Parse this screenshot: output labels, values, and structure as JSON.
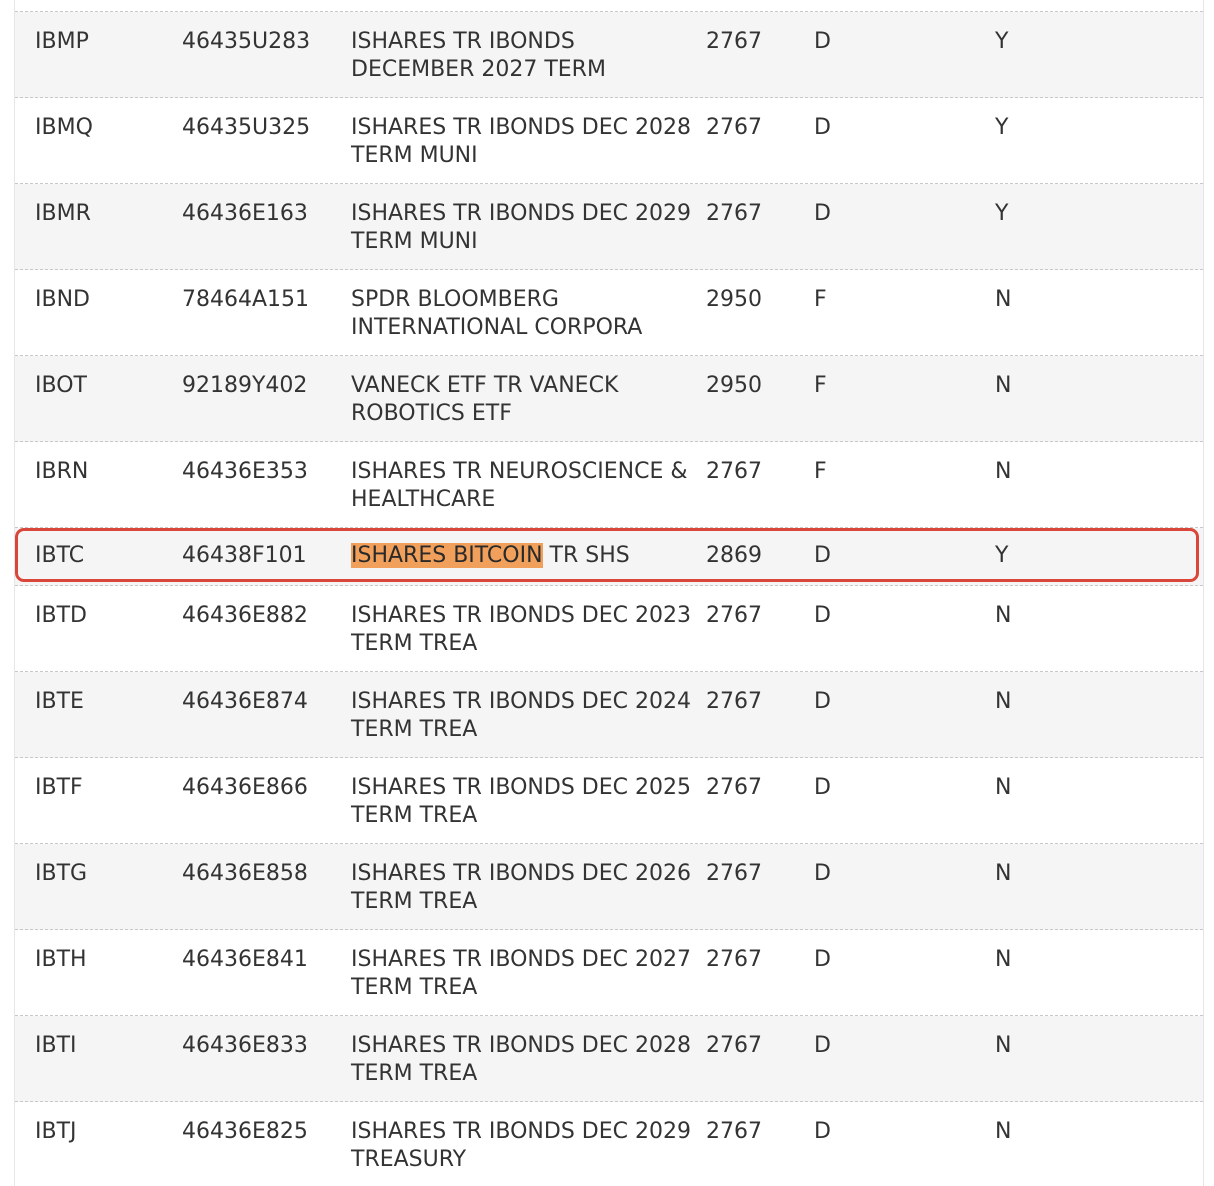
{
  "rows": [
    {
      "symbol": "IBMP",
      "cusip": "46435U283",
      "name1": "ISHARES TR IBONDS",
      "name2": "DECEMBER 2027 TERM",
      "code": "2767",
      "type": "D",
      "flag": "Y"
    },
    {
      "symbol": "IBMQ",
      "cusip": "46435U325",
      "name1": "ISHARES TR IBONDS DEC 2028",
      "name2": "TERM MUNI",
      "code": "2767",
      "type": "D",
      "flag": "Y"
    },
    {
      "symbol": "IBMR",
      "cusip": "46436E163",
      "name1": "ISHARES TR IBONDS DEC 2029",
      "name2": "TERM MUNI",
      "code": "2767",
      "type": "D",
      "flag": "Y"
    },
    {
      "symbol": "IBND",
      "cusip": "78464A151",
      "name1": "SPDR BLOOMBERG",
      "name2": "INTERNATIONAL CORPORA",
      "code": "2950",
      "type": "F",
      "flag": "N"
    },
    {
      "symbol": "IBOT",
      "cusip": "92189Y402",
      "name1": "VANECK ETF TR VANECK",
      "name2": "ROBOTICS ETF",
      "code": "2950",
      "type": "F",
      "flag": "N"
    },
    {
      "symbol": "IBRN",
      "cusip": "46436E353",
      "name1": "ISHARES TR NEUROSCIENCE &",
      "name2": "HEALTHCARE",
      "code": "2767",
      "type": "F",
      "flag": "N"
    },
    {
      "symbol": "IBTC",
      "cusip": "46438F101",
      "name_highlight": "ISHARES BITCOIN",
      "name_rest": " TR SHS",
      "code": "2869",
      "type": "D",
      "flag": "Y"
    },
    {
      "symbol": "IBTD",
      "cusip": "46436E882",
      "name1": "ISHARES TR IBONDS DEC 2023",
      "name2": "TERM TREA",
      "code": "2767",
      "type": "D",
      "flag": "N"
    },
    {
      "symbol": "IBTE",
      "cusip": "46436E874",
      "name1": "ISHARES TR IBONDS DEC 2024",
      "name2": "TERM TREA",
      "code": "2767",
      "type": "D",
      "flag": "N"
    },
    {
      "symbol": "IBTF",
      "cusip": "46436E866",
      "name1": "ISHARES TR IBONDS DEC 2025",
      "name2": "TERM TREA",
      "code": "2767",
      "type": "D",
      "flag": "N"
    },
    {
      "symbol": "IBTG",
      "cusip": "46436E858",
      "name1": "ISHARES TR IBONDS DEC 2026",
      "name2": "TERM TREA",
      "code": "2767",
      "type": "D",
      "flag": "N"
    },
    {
      "symbol": "IBTH",
      "cusip": "46436E841",
      "name1": "ISHARES TR IBONDS DEC 2027",
      "name2": "TERM TREA",
      "code": "2767",
      "type": "D",
      "flag": "N"
    },
    {
      "symbol": "IBTI",
      "cusip": "46436E833",
      "name1": "ISHARES TR IBONDS DEC 2028",
      "name2": "TERM TREA",
      "code": "2767",
      "type": "D",
      "flag": "N"
    },
    {
      "symbol": "IBTJ",
      "cusip": "46436E825",
      "name1": "ISHARES TR IBONDS DEC 2029",
      "name2": "TREASURY",
      "code": "2767",
      "type": "D",
      "flag": "N"
    }
  ],
  "colors": {
    "highlight_fill": "#f0a05a",
    "highlight_border": "#d9463a",
    "row_alt": "#f5f5f5",
    "text": "#333333"
  }
}
